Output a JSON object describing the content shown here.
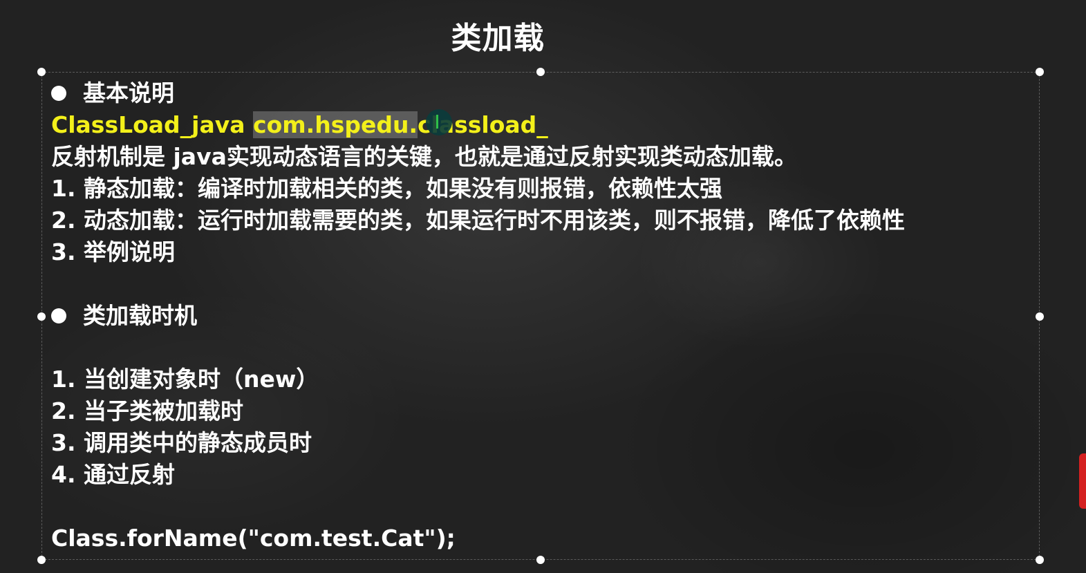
{
  "slide": {
    "title": "类加载",
    "sections": {
      "basic_heading": "基本说明",
      "path_label": "ClassLoad_java",
      "path_package_a": "com.hspedu.",
      "path_package_b": "classload_",
      "intro": "反射机制是 java实现动态语言的关键，也就是通过反射实现类动态加载。",
      "point_1": "1. 静态加载：编译时加载相关的类，如果没有则报错，依赖性太强",
      "point_2": "2. 动态加载：运行时加载需要的类，如果运行时不用该类，则不报错，降低了依赖性",
      "point_3": "3. 举例说明",
      "timing_heading": "类加载时机",
      "timing_1": "1. 当创建对象时（new）",
      "timing_2": "2. 当子类被加载时",
      "timing_3": "3. 调用类中的静态成员时",
      "timing_4": "4. 通过反射",
      "code_example": "Class.forName(\"com.test.Cat\");"
    }
  },
  "colors": {
    "background": "#262626",
    "text": "#ffffff",
    "highlight_yellow": "#f3f01a"
  }
}
